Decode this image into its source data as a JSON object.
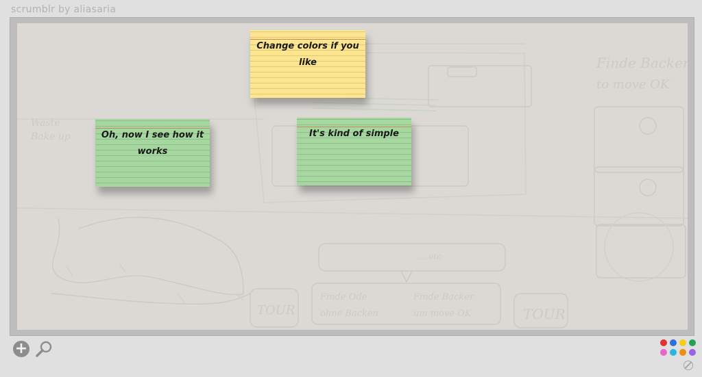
{
  "app": {
    "title": "scrumblr by aliasaria"
  },
  "cards": [
    {
      "id": "card-yellow",
      "text": "Change colors if you like",
      "color": "yellow"
    },
    {
      "id": "card-green-1",
      "text": "Oh, now I see how it works",
      "color": "green"
    },
    {
      "id": "card-green-2",
      "text": "It's kind of simple",
      "color": "green"
    }
  ],
  "toolbar": {
    "add_icon": "plus-circle-icon",
    "add_label": "+",
    "search_icon": "magnifier-icon"
  },
  "palette": {
    "colors": [
      "#e0322f",
      "#2d6fdc",
      "#f3cd1a",
      "#23a15b",
      "#e566c6",
      "#27b7e0",
      "#ef8d17",
      "#9b63e3"
    ],
    "no_color_icon": "no-color-icon"
  },
  "card_colors": {
    "yellow": "#fde68f",
    "green": "#a6d79f"
  }
}
